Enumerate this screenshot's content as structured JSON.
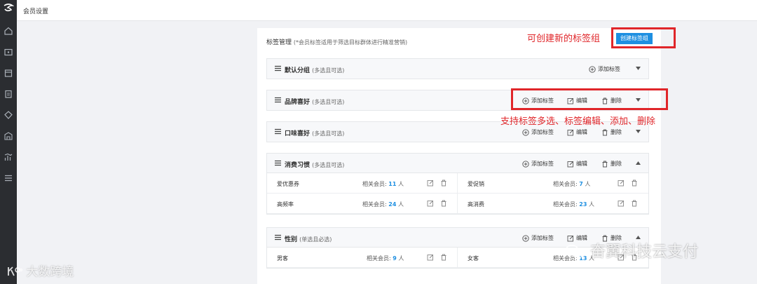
{
  "topbar": {
    "title": "会员设置"
  },
  "header": {
    "title": "标签管理",
    "note": "(*会员标签适用于筛选目标群体进行精准营销)",
    "create_button": "创建标签组"
  },
  "actions": {
    "add": "添加标签",
    "edit": "编辑",
    "delete": "删除"
  },
  "groups": [
    {
      "name": "默认分组",
      "note": "(多选且可选)",
      "expanded": false,
      "rows": []
    },
    {
      "name": "品牌喜好",
      "note": "(多选且可选)",
      "expanded": false,
      "rows": []
    },
    {
      "name": "口味喜好",
      "note": "(多选且可选)",
      "expanded": false,
      "rows": []
    },
    {
      "name": "消费习惯",
      "note": "(多选且可选)",
      "expanded": true,
      "rows": [
        {
          "name": "爱优惠券",
          "label": "相关会员:",
          "count": "11",
          "unit": "人"
        },
        {
          "name": "爱促销",
          "label": "相关会员:",
          "count": "7",
          "unit": "人"
        },
        {
          "name": "高频率",
          "label": "相关会员:",
          "count": "24",
          "unit": "人"
        },
        {
          "name": "高消费",
          "label": "相关会员:",
          "count": "23",
          "unit": "人"
        }
      ]
    },
    {
      "name": "性别",
      "note": "(单选且必选)",
      "expanded": true,
      "rows": [
        {
          "name": "男客",
          "label": "相关会员:",
          "count": "9",
          "unit": "人"
        },
        {
          "name": "女客",
          "label": "相关会员:",
          "count": "13",
          "unit": "人"
        }
      ]
    }
  ],
  "annotations": {
    "create": "可创建新的标签组",
    "actions": "支持标签多选、标签编辑、添加、删除"
  },
  "watermarks": {
    "left": "大数跨境",
    "right": "奋翼科技云支付"
  },
  "colors": {
    "accent": "#1e8fe1",
    "annotation": "#e0262a",
    "sidebar": "#2b2d31"
  }
}
